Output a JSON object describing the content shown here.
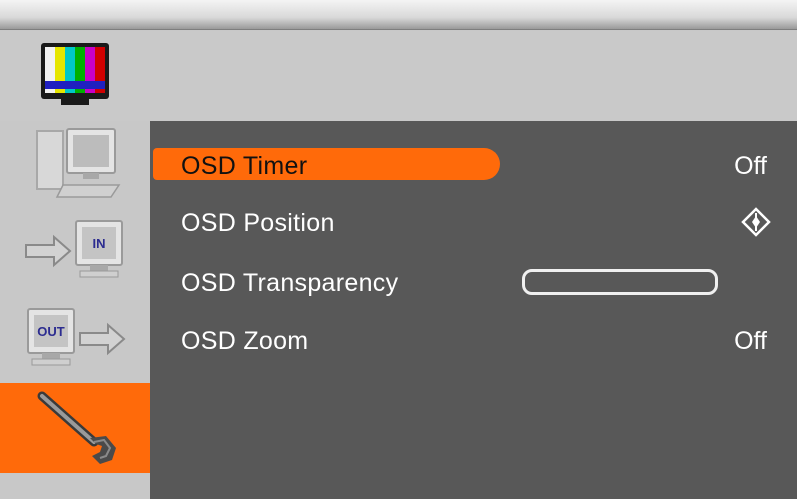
{
  "sidebar": {
    "items": [
      {
        "name": "picture",
        "icon": "color-bars-tv-icon"
      },
      {
        "name": "pc-setup",
        "icon": "computer-monitor-icon"
      },
      {
        "name": "input",
        "icon": "input-monitor-icon",
        "badge": "IN"
      },
      {
        "name": "output",
        "icon": "output-monitor-icon",
        "badge": "OUT"
      },
      {
        "name": "tools",
        "icon": "wrench-icon",
        "active": true
      }
    ]
  },
  "menu": {
    "items": [
      {
        "label": "OSD Timer",
        "value": "Off",
        "selected": true
      },
      {
        "label": "OSD Position",
        "icon": "position-diamond-icon"
      },
      {
        "label": "OSD Transparency",
        "level": 0
      },
      {
        "label": "OSD Zoom",
        "value": "Off"
      }
    ]
  },
  "colors": {
    "accent": "#ff6a0a",
    "panel": "#585858",
    "sidebar": "#c8c8c8"
  }
}
